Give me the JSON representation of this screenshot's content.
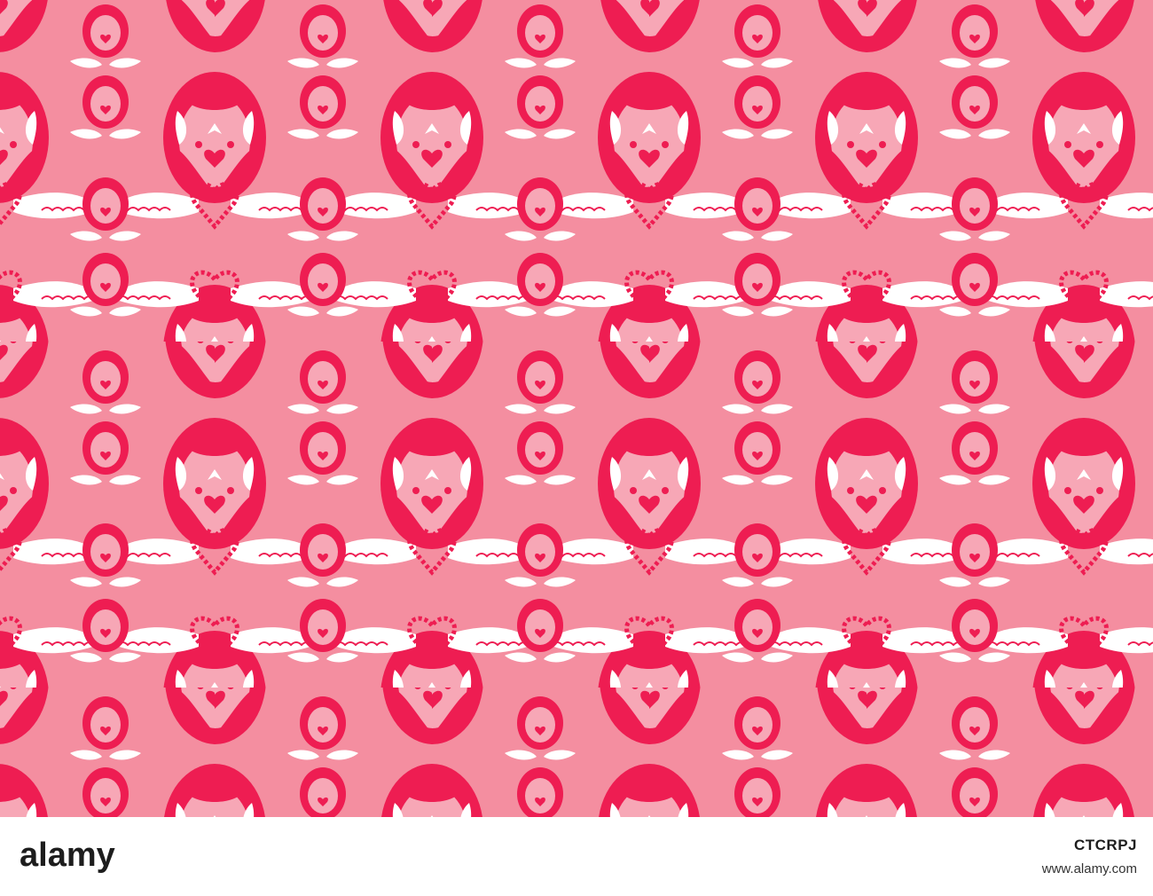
{
  "footer": {
    "logo_text": "alamy",
    "image_id": "CTCRPJ",
    "url": "www.alamy.com"
  },
  "pattern": {
    "icon": "winged-heart-damask-icon",
    "colors": {
      "background": "#f48ea0",
      "medallion": "#ee1d52",
      "medallion_inner": "#f7a7b6",
      "wing": "#ffffff",
      "footer": "#ffffff"
    }
  }
}
